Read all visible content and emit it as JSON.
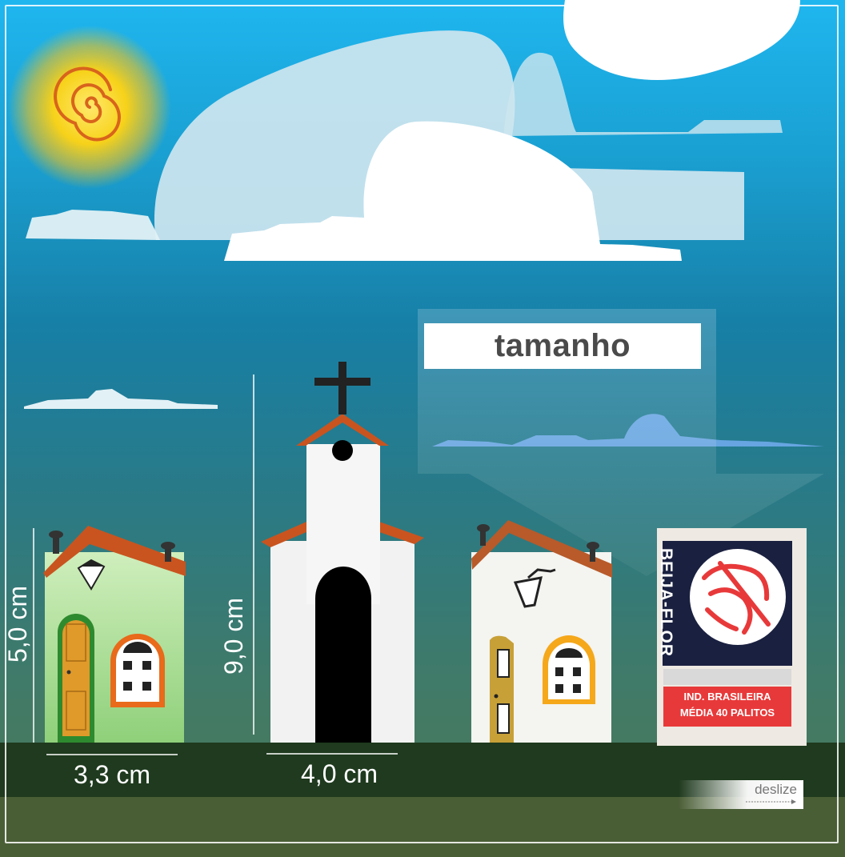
{
  "title": "tamanho",
  "dimensions": {
    "house_height": "5,0 cm",
    "house_width": "3,3 cm",
    "church_height": "9,0 cm",
    "church_width": "4,0 cm"
  },
  "matchbox": {
    "brand": "BEIJA-FLOR",
    "line1": "IND. BRASILEIRA",
    "line2": "MÉDIA 40 PALITOS"
  },
  "swipe_hint": "deslize",
  "colors": {
    "sky_top": "#1fb6ef",
    "ground": "#1e3a1e",
    "sun": "#f7d21a",
    "roof": "#c9541f",
    "match_red": "#e8393a"
  }
}
